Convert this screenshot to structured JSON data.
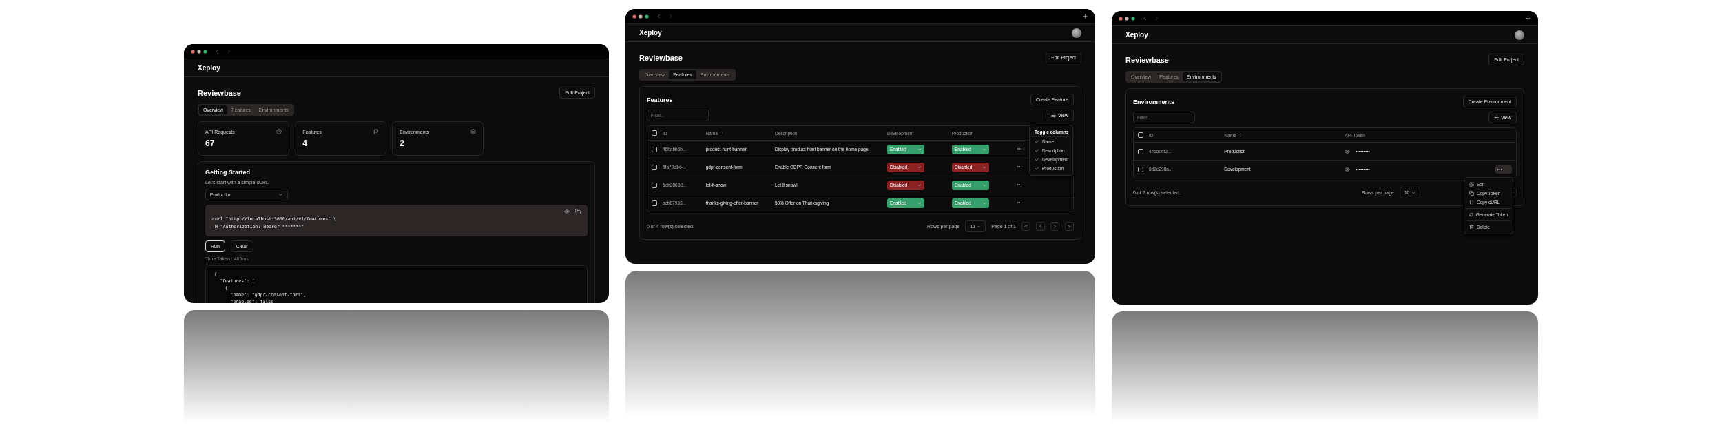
{
  "overview_window": {
    "app_name": "Xeploy",
    "project_title": "Reviewbase",
    "edit_button": "Edit Project",
    "tabs": [
      {
        "label": "Overview",
        "selected": true
      },
      {
        "label": "Features",
        "selected": false
      },
      {
        "label": "Environments",
        "selected": false
      }
    ],
    "stats": [
      {
        "label": "API Requests",
        "value": "67"
      },
      {
        "label": "Features",
        "value": "4"
      },
      {
        "label": "Environments",
        "value": "2"
      }
    ],
    "getting_started": {
      "title": "Getting Started",
      "subtitle": "Let's start with a simple cURL",
      "environment_select": "Production",
      "code_lines": [
        "curl \"http://localhost:3000/api/v1/features\" \\",
        "-H \"Authorization: Bearer *******\""
      ],
      "buttons": [
        {
          "label": "Run",
          "selected": true
        },
        {
          "label": "Clear",
          "selected": false
        }
      ],
      "time_taken": "Time Taken : 465ms",
      "response_lines": [
        "{",
        "  \"features\": [",
        "    {",
        "      \"name\": \"gdpr-consent-form\",",
        "      \"enabled\": false"
      ]
    }
  },
  "features_window": {
    "title_bar": {
      "new_tab_button": true,
      "avatar": true
    },
    "app_name": "Xeploy",
    "project_title": "Reviewbase",
    "edit_button": "Edit Project",
    "tabs": [
      {
        "label": "Overview",
        "selected": false
      },
      {
        "label": "Features",
        "selected": true
      },
      {
        "label": "Environments",
        "selected": false
      }
    ],
    "card_title": "Features",
    "create_button": "Create Feature",
    "filter": {
      "placeholder": "Filter..."
    },
    "view_button": "View",
    "table": {
      "header_selected": false,
      "columns": [
        "ID",
        "Name",
        "Description",
        "Development",
        "Production"
      ],
      "rows": [
        {
          "selected": false,
          "id": "46babb6b...",
          "name": "product-hunt-banner",
          "description": "Display product hunt banner on the home page.",
          "development": {
            "label": "Enabled",
            "enabled": true
          },
          "production": {
            "label": "Enabled",
            "enabled": true
          }
        },
        {
          "selected": false,
          "id": "5fa79c1d-...",
          "name": "gdpr-consent-form",
          "description": "Enable GDPR Consent form",
          "development": {
            "label": "Disabled",
            "enabled": false
          },
          "production": {
            "label": "Disabled",
            "enabled": false
          }
        },
        {
          "selected": false,
          "id": "6db2868d...",
          "name": "let-it-snow",
          "description": "Let it snow!",
          "development": {
            "label": "Disabled",
            "enabled": false
          },
          "production": {
            "label": "Enabled",
            "enabled": true
          }
        },
        {
          "selected": false,
          "id": "acb87933...",
          "name": "thanks-giving-offer-banner",
          "description": "50% Offer on Thanksgiving",
          "development": {
            "label": "Enabled",
            "enabled": true
          },
          "production": {
            "label": "Enabled",
            "enabled": true
          }
        }
      ]
    },
    "column_menu": {
      "title": "Toggle columns",
      "items": [
        {
          "label": "Name",
          "checked": true
        },
        {
          "label": "Description",
          "checked": true
        },
        {
          "label": "Development",
          "checked": true
        },
        {
          "label": "Production",
          "checked": true
        }
      ]
    },
    "footer": {
      "selection": "0 of 4 row(s) selected.",
      "rows_per_page_label": "Rows per page",
      "rows_per_page": "10",
      "page": "Page 1 of 1"
    }
  },
  "environments_window": {
    "title_bar": {
      "new_tab_button": true,
      "avatar": true
    },
    "app_name": "Xeploy",
    "project_title": "Reviewbase",
    "edit_button": "Edit Project",
    "tabs": [
      {
        "label": "Overview",
        "selected": false
      },
      {
        "label": "Features",
        "selected": false
      },
      {
        "label": "Environments",
        "selected": true
      }
    ],
    "card_title": "Environments",
    "create_button": "Create Environment",
    "filter": {
      "placeholder": "Filter..."
    },
    "view_button": "View",
    "table": {
      "header_selected": false,
      "columns": [
        "ID",
        "Name",
        "API Token"
      ],
      "rows": [
        {
          "selected": false,
          "id": "44650fd2...",
          "name": "Production",
          "token": "•••••••••",
          "menu_open": false
        },
        {
          "selected": false,
          "id": "8d2e298a...",
          "name": "Development",
          "token": "•••••••••",
          "menu_open": true
        }
      ]
    },
    "row_menu": {
      "items": [
        {
          "kind": "edit",
          "label": "Edit"
        },
        {
          "kind": "copy",
          "label": "Copy Token"
        },
        {
          "kind": "code",
          "label": "Copy cURL"
        },
        {
          "kind": "regenerate",
          "label": "Generate Token"
        },
        {
          "kind": "delete",
          "label": "Delete"
        }
      ]
    },
    "footer": {
      "selection": "0 of 2 row(s) selected.",
      "rows_per_page_label": "Rows per page",
      "rows_per_page": "10"
    }
  }
}
